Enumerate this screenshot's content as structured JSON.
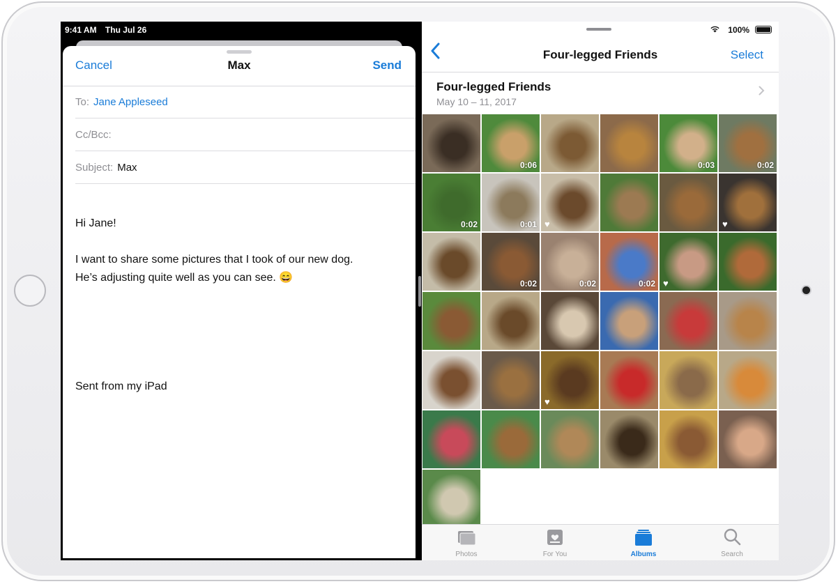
{
  "status": {
    "time": "9:41 AM",
    "date": "Thu Jul 26",
    "battery": "100%"
  },
  "mail": {
    "cancel": "Cancel",
    "title": "Max",
    "send": "Send",
    "to_label": "To:",
    "to_value": "Jane Appleseed",
    "cc_label": "Cc/Bcc:",
    "subject_label": "Subject:",
    "subject_value": "Max",
    "greeting": "Hi Jane!",
    "line1": "I want to share some pictures that I took of our new dog.",
    "line2": "He’s adjusting quite well as you can see. 😄",
    "signature": "Sent from my iPad"
  },
  "album": {
    "nav_title": "Four-legged Friends",
    "select": "Select",
    "header_title": "Four-legged Friends",
    "header_date": "May 10 – 11, 2017"
  },
  "photos": [
    {
      "color": "#7a6a58",
      "accent": "#3a2e24",
      "duration": "",
      "favorite": false
    },
    {
      "color": "#4f8a3c",
      "accent": "#c9a06a",
      "duration": "0:06",
      "favorite": false
    },
    {
      "color": "#b8a888",
      "accent": "#7c5a34",
      "duration": "",
      "favorite": false
    },
    {
      "color": "#8c6a4a",
      "accent": "#b8843e",
      "duration": "",
      "favorite": false
    },
    {
      "color": "#4c8a3a",
      "accent": "#d2b08a",
      "duration": "0:03",
      "favorite": false
    },
    {
      "color": "#6e7a62",
      "accent": "#a07040",
      "duration": "0:02",
      "favorite": false
    },
    {
      "color": "#4a7e34",
      "accent": "#3f6b2c",
      "duration": "0:02",
      "favorite": false
    },
    {
      "color": "#c8c4bc",
      "accent": "#8c7a5c",
      "duration": "0:01",
      "favorite": false
    },
    {
      "color": "#c8bda8",
      "accent": "#6b4a2c",
      "duration": "",
      "favorite": true
    },
    {
      "color": "#4f7a38",
      "accent": "#9c7a52",
      "duration": "",
      "favorite": false
    },
    {
      "color": "#6a5a40",
      "accent": "#9a6a3a",
      "duration": "",
      "favorite": false
    },
    {
      "color": "#3a3430",
      "accent": "#a0703c",
      "duration": "",
      "favorite": true
    },
    {
      "color": "#c4bca8",
      "accent": "#6a4a2a",
      "duration": "",
      "favorite": false
    },
    {
      "color": "#5a4a3a",
      "accent": "#8a5a34",
      "duration": "0:02",
      "favorite": false
    },
    {
      "color": "#9a8270",
      "accent": "#c8b098",
      "duration": "0:02",
      "favorite": false
    },
    {
      "color": "#b86a4a",
      "accent": "#4a7ac8",
      "duration": "0:02",
      "favorite": false
    },
    {
      "color": "#3e6a2e",
      "accent": "#c89a84",
      "duration": "",
      "favorite": true
    },
    {
      "color": "#3a6a2c",
      "accent": "#b06a3a",
      "duration": "",
      "favorite": false
    },
    {
      "color": "#5a8a3c",
      "accent": "#8a5a34",
      "duration": "",
      "favorite": false
    },
    {
      "color": "#b8a888",
      "accent": "#6a4a2a",
      "duration": "",
      "favorite": false
    },
    {
      "color": "#5a4838",
      "accent": "#d8c8b0",
      "duration": "",
      "favorite": false
    },
    {
      "color": "#3a6ab0",
      "accent": "#c8a07a",
      "duration": "",
      "favorite": false
    },
    {
      "color": "#8a6a52",
      "accent": "#c83a3a",
      "duration": "",
      "favorite": false
    },
    {
      "color": "#a89a88",
      "accent": "#b8844a",
      "duration": "",
      "favorite": false
    },
    {
      "color": "#d8d4cc",
      "accent": "#7a5030",
      "duration": "",
      "favorite": false
    },
    {
      "color": "#6a5a4a",
      "accent": "#9a7040",
      "duration": "",
      "favorite": false
    },
    {
      "color": "#8a6a2a",
      "accent": "#5a3a20",
      "duration": "",
      "favorite": true
    },
    {
      "color": "#a87a54",
      "accent": "#c82a2a",
      "duration": "",
      "favorite": false
    },
    {
      "color": "#c8a85a",
      "accent": "#8a6a4a",
      "duration": "",
      "favorite": false
    },
    {
      "color": "#b8a888",
      "accent": "#d88a3a",
      "duration": "",
      "favorite": false
    },
    {
      "color": "#3a7a4a",
      "accent": "#c84a5a",
      "duration": "",
      "favorite": false
    },
    {
      "color": "#4a8a4a",
      "accent": "#9a6a3a",
      "duration": "",
      "favorite": false
    },
    {
      "color": "#6a8a5a",
      "accent": "#b08858",
      "duration": "",
      "favorite": false
    },
    {
      "color": "#9a8a6a",
      "accent": "#3a2a1a",
      "duration": "",
      "favorite": false
    },
    {
      "color": "#c8a04a",
      "accent": "#8a5a34",
      "duration": "",
      "favorite": false
    },
    {
      "color": "#7a6050",
      "accent": "#d8a888",
      "duration": "",
      "favorite": false
    },
    {
      "color": "#5a8a4a",
      "accent": "#d0c8b0",
      "duration": "",
      "favorite": false
    }
  ],
  "tabs": [
    {
      "label": "Photos",
      "icon": "photos-icon",
      "active": false
    },
    {
      "label": "For You",
      "icon": "for-you-icon",
      "active": false
    },
    {
      "label": "Albums",
      "icon": "albums-icon",
      "active": true
    },
    {
      "label": "Search",
      "icon": "search-icon",
      "active": false
    }
  ],
  "colors": {
    "accent": "#1a7cd8",
    "tab_inactive": "#999999"
  }
}
